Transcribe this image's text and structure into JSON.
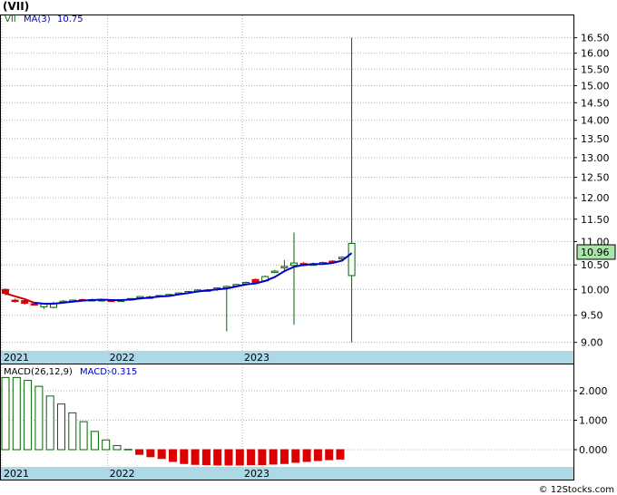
{
  "title": "(VII)",
  "credit": "© 12Stocks.com",
  "colors": {
    "up": "#ffffff",
    "down": "#dd0000",
    "wick": "#006600",
    "ma": "#0000cc",
    "ma_early": "#cc0000",
    "macd_pos": "#006600",
    "macd_neg": "#dd0000",
    "date_band": "#add8e6",
    "grid": "#b0b0b0",
    "last_price_bg": "#a8e6a8",
    "legend_ticker": "#007700",
    "legend_value": "#0000cc"
  },
  "chart_data": [
    {
      "type": "candlestick",
      "legend": {
        "ticker": "VII",
        "indicator": "MA(3)",
        "value": "10.75"
      },
      "last_price_label": "10.96",
      "y_ticks": [
        "16.50",
        "16.00",
        "15.50",
        "15.00",
        "14.50",
        "14.00",
        "13.50",
        "13.00",
        "12.50",
        "12.00",
        "11.50",
        "11.00",
        "10.50",
        "10.00",
        "9.50",
        "9.00"
      ],
      "x_ticks": [
        {
          "label": "2021",
          "pos": 0
        },
        {
          "label": "2022",
          "pos": 11
        },
        {
          "label": "2023",
          "pos": 25
        }
      ],
      "scale": "log",
      "grid": true,
      "candles": [
        {
          "o": 10.0,
          "h": 10.02,
          "l": 9.88,
          "c": 9.92
        },
        {
          "o": 9.79,
          "h": 9.82,
          "l": 9.74,
          "c": 9.78
        },
        {
          "o": 9.78,
          "h": 9.8,
          "l": 9.7,
          "c": 9.73
        },
        {
          "o": 9.72,
          "h": 9.74,
          "l": 9.69,
          "c": 9.71
        },
        {
          "o": 9.66,
          "h": 9.74,
          "l": 9.62,
          "c": 9.72
        },
        {
          "o": 9.65,
          "h": 9.76,
          "l": 9.63,
          "c": 9.73
        },
        {
          "o": 9.76,
          "h": 9.79,
          "l": 9.74,
          "c": 9.77
        },
        {
          "o": 9.77,
          "h": 9.8,
          "l": 9.75,
          "c": 9.79
        },
        {
          "o": 9.8,
          "h": 9.82,
          "l": 9.76,
          "c": 9.79
        },
        {
          "o": 9.79,
          "h": 9.82,
          "l": 9.77,
          "c": 9.8
        },
        {
          "o": 9.78,
          "h": 9.81,
          "l": 9.76,
          "c": 9.8
        },
        {
          "o": 9.79,
          "h": 9.81,
          "l": 9.77,
          "c": 9.78
        },
        {
          "o": 9.78,
          "h": 9.8,
          "l": 9.76,
          "c": 9.79
        },
        {
          "o": 9.8,
          "h": 9.83,
          "l": 9.78,
          "c": 9.82
        },
        {
          "o": 9.84,
          "h": 9.87,
          "l": 9.82,
          "c": 9.86
        },
        {
          "o": 9.85,
          "h": 9.88,
          "l": 9.83,
          "c": 9.84
        },
        {
          "o": 9.86,
          "h": 9.89,
          "l": 9.84,
          "c": 9.88
        },
        {
          "o": 9.89,
          "h": 9.91,
          "l": 9.86,
          "c": 9.9
        },
        {
          "o": 9.91,
          "h": 9.94,
          "l": 9.89,
          "c": 9.93
        },
        {
          "o": 9.94,
          "h": 9.97,
          "l": 9.91,
          "c": 9.96
        },
        {
          "o": 9.97,
          "h": 10.0,
          "l": 9.94,
          "c": 9.99
        },
        {
          "o": 9.99,
          "h": 10.01,
          "l": 9.96,
          "c": 9.98
        },
        {
          "o": 10.0,
          "h": 10.04,
          "l": 9.97,
          "c": 10.03
        },
        {
          "o": 10.04,
          "h": 10.08,
          "l": 9.2,
          "c": 10.06
        },
        {
          "o": 10.07,
          "h": 10.11,
          "l": 10.05,
          "c": 10.1
        },
        {
          "o": 10.12,
          "h": 10.16,
          "l": 10.08,
          "c": 10.14
        },
        {
          "o": 10.2,
          "h": 10.22,
          "l": 10.1,
          "c": 10.12
        },
        {
          "o": 10.17,
          "h": 10.28,
          "l": 10.15,
          "c": 10.26
        },
        {
          "o": 10.36,
          "h": 10.4,
          "l": 10.33,
          "c": 10.37
        },
        {
          "o": 10.44,
          "h": 10.6,
          "l": 10.38,
          "c": 10.47
        },
        {
          "o": 10.49,
          "h": 11.2,
          "l": 9.32,
          "c": 10.54
        },
        {
          "o": 10.53,
          "h": 10.56,
          "l": 10.47,
          "c": 10.49
        },
        {
          "o": 10.51,
          "h": 10.55,
          "l": 10.48,
          "c": 10.52
        },
        {
          "o": 10.53,
          "h": 10.57,
          "l": 10.5,
          "c": 10.55
        },
        {
          "o": 10.58,
          "h": 10.6,
          "l": 10.53,
          "c": 10.55
        },
        {
          "o": 10.63,
          "h": 10.68,
          "l": 10.6,
          "c": 10.66
        },
        {
          "o": 10.28,
          "h": 16.5,
          "l": 9.0,
          "c": 10.96
        }
      ],
      "ma": [
        null,
        null,
        9.81,
        9.74,
        9.72,
        9.72,
        9.74,
        9.76,
        9.78,
        9.79,
        9.8,
        9.79,
        9.79,
        9.8,
        9.82,
        9.84,
        9.86,
        9.87,
        9.9,
        9.93,
        9.96,
        9.98,
        10.0,
        10.02,
        10.06,
        10.1,
        10.12,
        10.17,
        10.25,
        10.37,
        10.46,
        10.5,
        10.52,
        10.52,
        10.54,
        10.59,
        10.75
      ]
    },
    {
      "type": "bar",
      "legend": {
        "indicator": "MACD(26,12,9)",
        "label": "MACD:",
        "value": "-0.315"
      },
      "y_ticks": [
        "2.000",
        "1.000",
        "0.000"
      ],
      "x_ticks": [
        {
          "label": "2021",
          "pos": 0
        },
        {
          "label": "2022",
          "pos": 11
        },
        {
          "label": "2023",
          "pos": 25
        }
      ],
      "values": [
        2.45,
        2.45,
        2.35,
        2.15,
        1.82,
        1.55,
        1.25,
        0.95,
        0.62,
        0.33,
        0.14,
        0.01,
        -0.16,
        -0.24,
        -0.3,
        -0.4,
        -0.47,
        -0.5,
        -0.51,
        -0.52,
        -0.52,
        -0.52,
        -0.51,
        -0.51,
        -0.49,
        -0.47,
        -0.43,
        -0.4,
        -0.37,
        -0.34,
        -0.32
      ]
    }
  ]
}
